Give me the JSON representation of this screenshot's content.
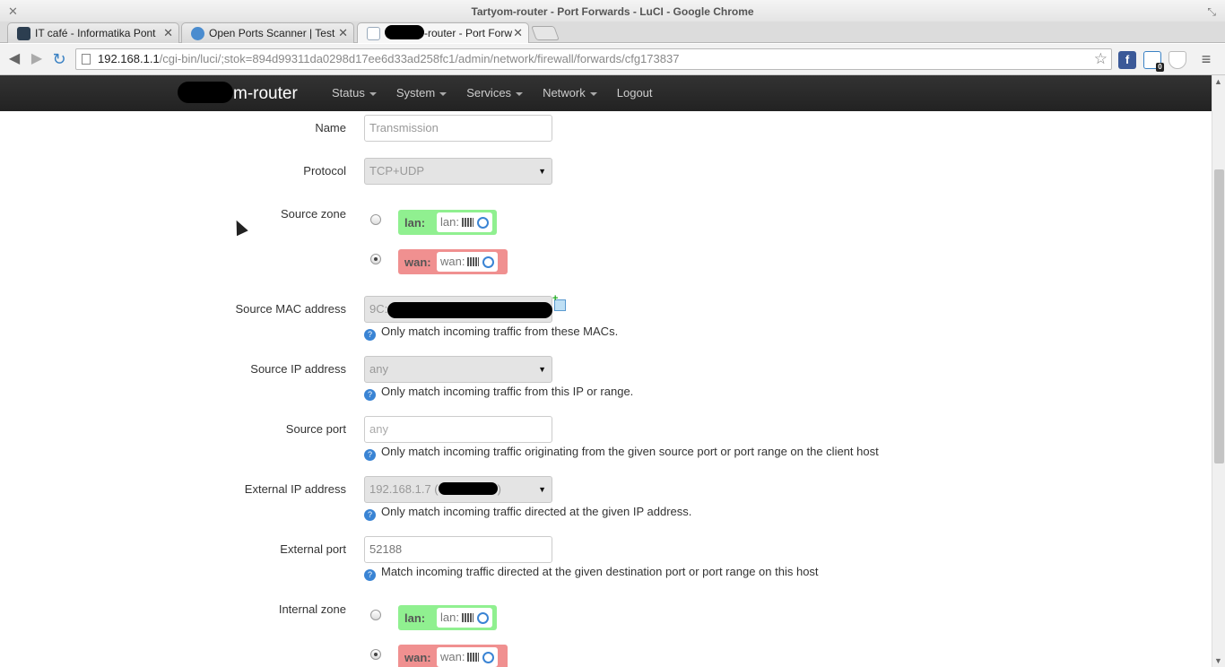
{
  "window": {
    "title": "Tartyom-router - Port Forwards - LuCI - Google Chrome"
  },
  "tabs": [
    {
      "label": "IT café - Informatika Pont",
      "icon": "site-icon"
    },
    {
      "label": "Open Ports Scanner | Test",
      "icon": "globe-icon"
    },
    {
      "label": "-router - Port Forw",
      "icon": "luci-icon"
    }
  ],
  "address": {
    "host": "192.168.1.1",
    "path": "/cgi-bin/luci/;stok=894d99311da0298d17ee6d33ad258fc1/admin/network/firewall/forwards/cfg173837"
  },
  "extensions": {
    "facebook": "f",
    "badge_count": "0"
  },
  "header": {
    "brand": "m-router",
    "menu": [
      "Status",
      "System",
      "Services",
      "Network",
      "Logout"
    ]
  },
  "form": {
    "name": {
      "label": "Name",
      "value": "Transmission"
    },
    "protocol": {
      "label": "Protocol",
      "value": "TCP+UDP"
    },
    "source_zone": {
      "label": "Source zone",
      "options": [
        {
          "zone": "lan:",
          "iface": "lan:",
          "selected": false
        },
        {
          "zone": "wan:",
          "iface": "wan:",
          "selected": true
        }
      ]
    },
    "source_mac": {
      "label": "Source MAC address",
      "value": "9C:",
      "hint": "Only match incoming traffic from these MACs."
    },
    "source_ip": {
      "label": "Source IP address",
      "value": "any",
      "hint": "Only match incoming traffic from this IP or range."
    },
    "source_port": {
      "label": "Source port",
      "placeholder": "any",
      "hint": "Only match incoming traffic originating from the given source port or port range on the client host"
    },
    "external_ip": {
      "label": "External IP address",
      "value": "192.168.1.7 (",
      "value_tail": ")",
      "hint": "Only match incoming traffic directed at the given IP address."
    },
    "external_port": {
      "label": "External port",
      "value": "52188",
      "hint": "Match incoming traffic directed at the given destination port or port range on this host"
    },
    "internal_zone": {
      "label": "Internal zone",
      "options": [
        {
          "zone": "lan:",
          "iface": "lan:",
          "selected": false
        },
        {
          "zone": "wan:",
          "iface": "wan:",
          "selected": true
        }
      ]
    }
  }
}
